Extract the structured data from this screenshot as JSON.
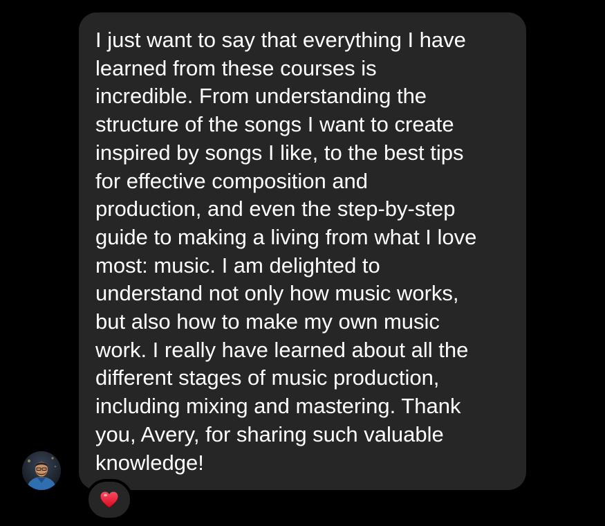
{
  "chat": {
    "message": {
      "lines": [
        "I just want to say that everything I have",
        "learned from these courses is",
        "incredible. From understanding the",
        "structure of the songs I want to create",
        "inspired by songs I like, to the best tips",
        "for effective composition and",
        "production, and even the step-by-step",
        "guide to making a living from what I love",
        "most: music. I am delighted to",
        "understand not only how music works,",
        "but also how to make my own music",
        "work. I really have learned about all the",
        "different stages of music production,",
        "including mixing and mastering. Thank",
        "you, Avery, for sharing such valuable",
        "knowledge!"
      ]
    },
    "sender_avatar_icon": "user-avatar",
    "reaction_icon": "red-heart-icon"
  },
  "colors": {
    "background": "#000000",
    "bubble": "#262626",
    "text": "#ffffff",
    "heart": "#e8102b"
  }
}
